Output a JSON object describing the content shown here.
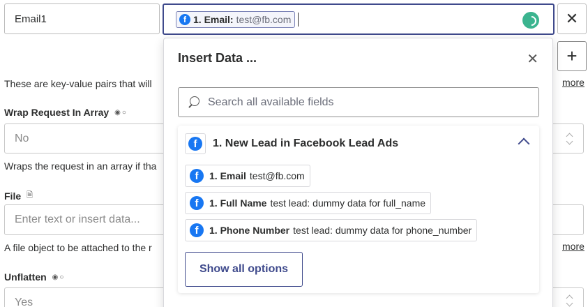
{
  "key_field": {
    "value": "Email1"
  },
  "value_field": {
    "pill_label": "1. Email:",
    "pill_value": "test@fb.com"
  },
  "buttons": {
    "remove": "✕",
    "add": "+"
  },
  "background_form": {
    "description_text": "These are key-value pairs that will",
    "more_link_1": "more",
    "wrap_label": "Wrap Request In Array",
    "wrap_marks": "◉○",
    "wrap_value": "No",
    "wrap_help": "Wraps the request in an array if tha",
    "file_label": "File",
    "file_icon": "🗎",
    "file_placeholder": "Enter text or insert data...",
    "file_help": "A file object to be attached to the r",
    "more_link_2": "more",
    "unflatten_label": "Unflatten",
    "unflatten_marks": "◉○",
    "unflatten_value": "Yes"
  },
  "insert_panel": {
    "title": "Insert Data ...",
    "close": "✕",
    "search_placeholder": "Search all available fields",
    "group": {
      "title": "1. New Lead in Facebook Lead Ads",
      "items": [
        {
          "label": "1. Email",
          "value": "test@fb.com"
        },
        {
          "label": "1. Full Name",
          "value": "test lead: dummy data for full_name"
        },
        {
          "label": "1. Phone Number",
          "value": "test lead: dummy data for phone_number"
        }
      ],
      "show_all_label": "Show all options"
    }
  },
  "icons": {
    "facebook": "facebook-icon",
    "search": "search-icon",
    "spinner": "loading-spinner-icon"
  },
  "colors": {
    "accent": "#3f4a8c",
    "facebook": "#1877f2",
    "spinner": "#3bb48f"
  }
}
